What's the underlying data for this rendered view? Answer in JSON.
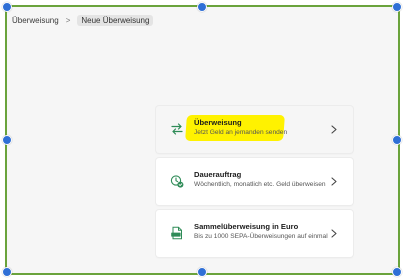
{
  "breadcrumb": {
    "items": [
      "Überweisung",
      "Neue Überweisung"
    ]
  },
  "options": [
    {
      "title": "Überweisung",
      "subtitle": "Jetzt Geld an jemanden senden",
      "icon": "arrows-swap-icon",
      "highlighted": true
    },
    {
      "title": "Dauerauftrag",
      "subtitle": "Wöchentlich, monatlich etc. Geld überweisen",
      "icon": "clock-check-icon",
      "highlighted": false
    },
    {
      "title": "Sammelüberweisung in Euro",
      "subtitle": "Bis zu 1000 SEPA-Überweisungen auf einmal",
      "icon": "csv-file-icon",
      "highlighted": false
    }
  ],
  "colors": {
    "frame": "#6aa33c",
    "handles": "#2f6fd6",
    "highlight": "#fff200",
    "icon_green": "#2e8b57"
  }
}
